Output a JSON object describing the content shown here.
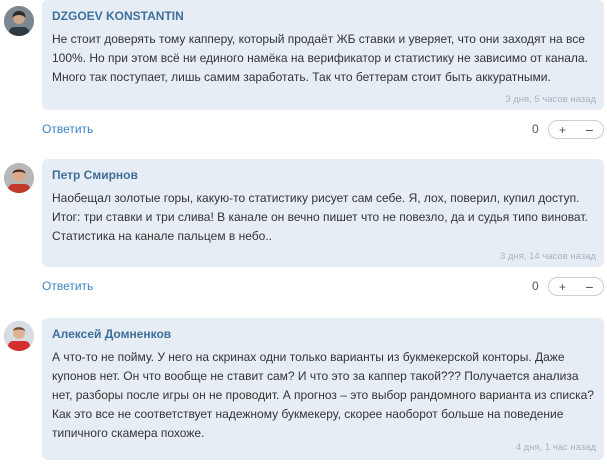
{
  "comments": [
    {
      "author": "DZGOEV KONSTANTIN",
      "text": "Не стоит доверять тому капперу, который продаёт ЖБ ставки и уверяет, что они заходят на все 100%. Но при этом всё ни единого намёка на верификатор и статистику не зависимо от канала. Много так поступает, лишь самим заработать. Так что беттерам стоит быть аккуратными.",
      "date": "3 дня, 5 часов назад",
      "reply": "Ответить",
      "score": "0",
      "plus": "+",
      "minus": "−"
    },
    {
      "author": "Петр Смирнов",
      "text": "Наобещал золотые горы, какую-то статистику рисует сам себе. Я, лох, поверил, купил доступ. Итог: три ставки и три слива! В канале он вечно пишет что не повезло, да и судья типо виноват. Статистика на канале пальцем в небо..",
      "date": "3 дня, 14 часов назад",
      "reply": "Ответить",
      "score": "0",
      "plus": "+",
      "minus": "−"
    },
    {
      "author": "Алексей Домненков",
      "text": "А что-то не пойму. У него на скринах одни только варианты из букмекерской конторы. Даже купонов нет. Он что вообще не ставит сам? И что это за каппер такой??? Получается анализа нет, разборы после игры он не проводит. А прогноз – это выбор рандомного варианта из списка? Как это все не соответствует надежному букмекеру, скорее наоборот больше на поведение типичного скамера похоже.",
      "date": "4 дня, 1 час назад"
    }
  ],
  "colors": {
    "bubble": "#e7edf5",
    "author": "#3d6f99",
    "reply": "#3b82c4",
    "date": "#a8b3be"
  },
  "icons": [
    "avatar-photo",
    "plus-icon",
    "minus-icon"
  ]
}
